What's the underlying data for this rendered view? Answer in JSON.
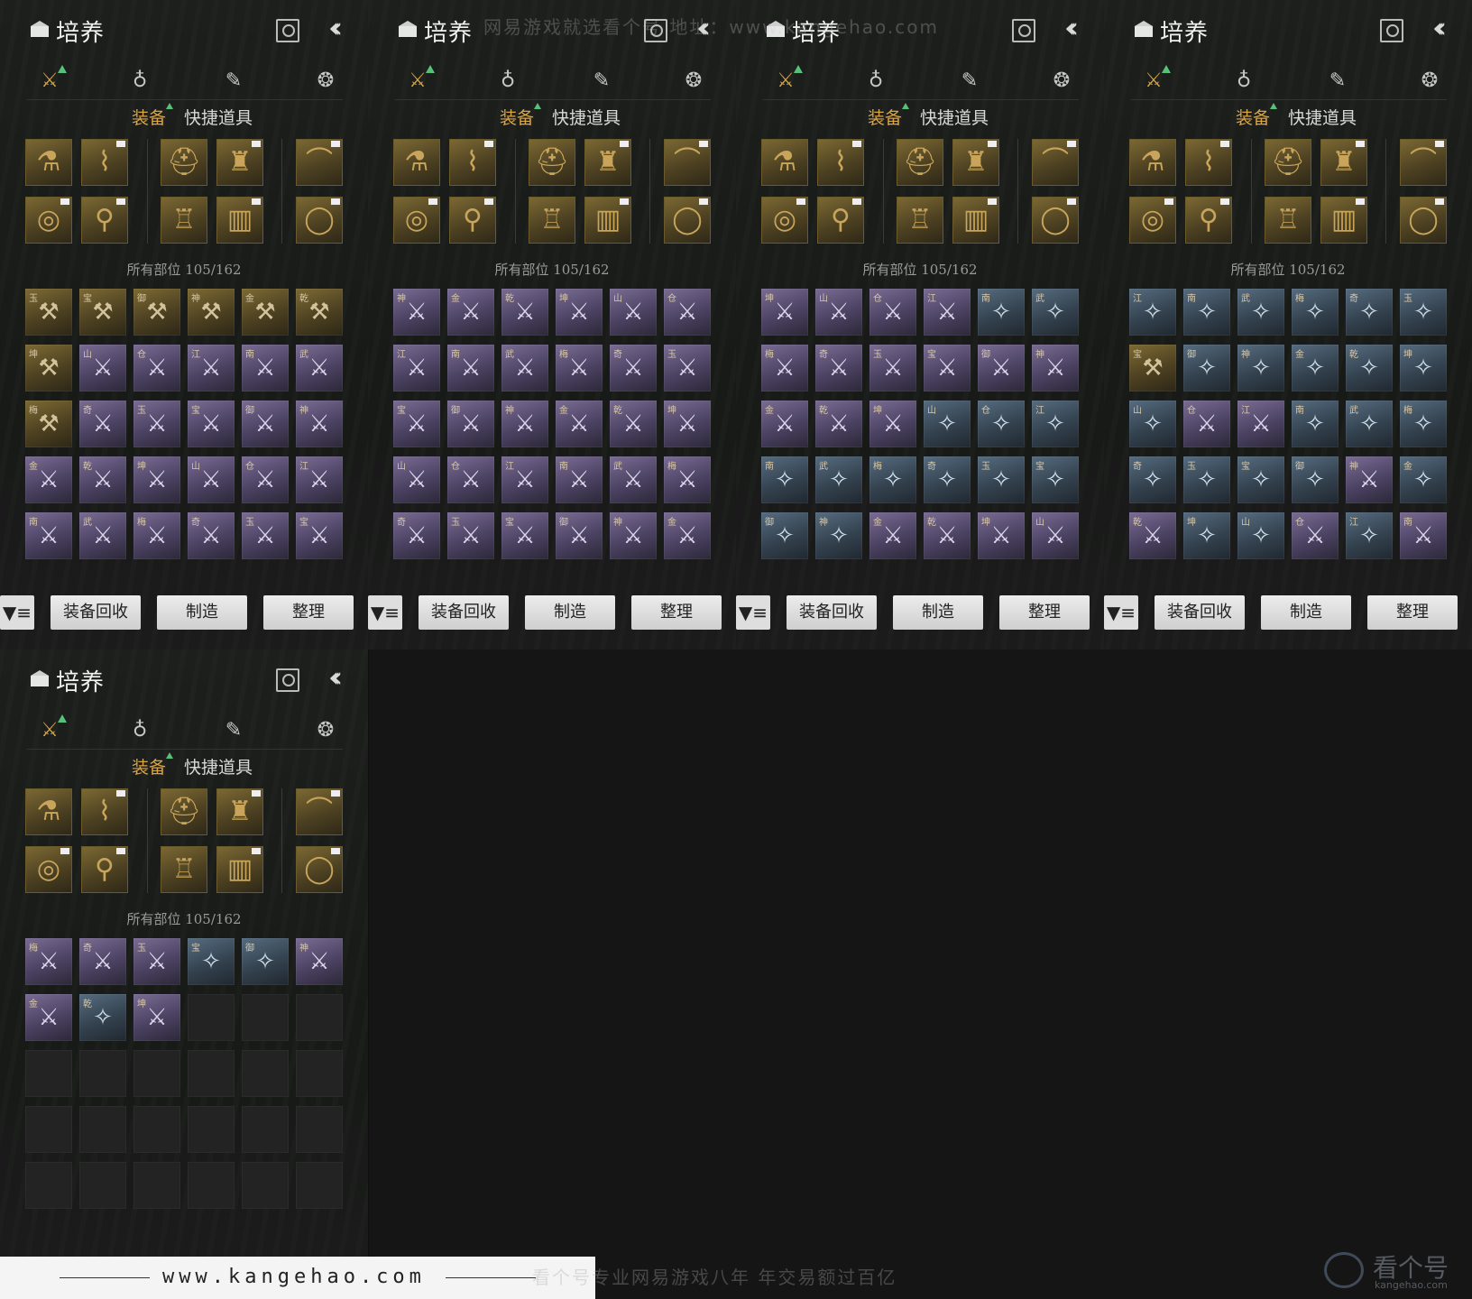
{
  "header": {
    "title": "培养",
    "title_icon": "chest-icon",
    "search_icon": "search-icon",
    "collapse_icon": "double-chevron-left-icon"
  },
  "top_tabs": [
    {
      "name": "crossed-swords-icon",
      "glyph": "⚔",
      "active": true,
      "new": true
    },
    {
      "name": "pouch-icon",
      "glyph": "♁",
      "active": false,
      "new": false
    },
    {
      "name": "scroll-icon",
      "glyph": "✎",
      "active": false,
      "new": false
    },
    {
      "name": "gourd-icon",
      "glyph": "❂",
      "active": false,
      "new": false
    }
  ],
  "sub_tabs": {
    "equipment": "装备",
    "quick_items": "快捷道具"
  },
  "count_text": "所有部位 105/162",
  "buttons": {
    "filter_icon": "filter-icon",
    "recycle": "装备回收",
    "craft": "制造",
    "sort": "整理"
  },
  "watermark": {
    "top": "网易游戏就选看个号    地址：www.kangehao.com",
    "url": "www.kangehao.com",
    "slogan": "看个号专业网易游戏八年    年交易额过百亿",
    "logo": "看个号",
    "logo_sub": "kangehao.com"
  },
  "colors": {
    "accent": "#d9a441",
    "new_dot": "#59c07a"
  }
}
